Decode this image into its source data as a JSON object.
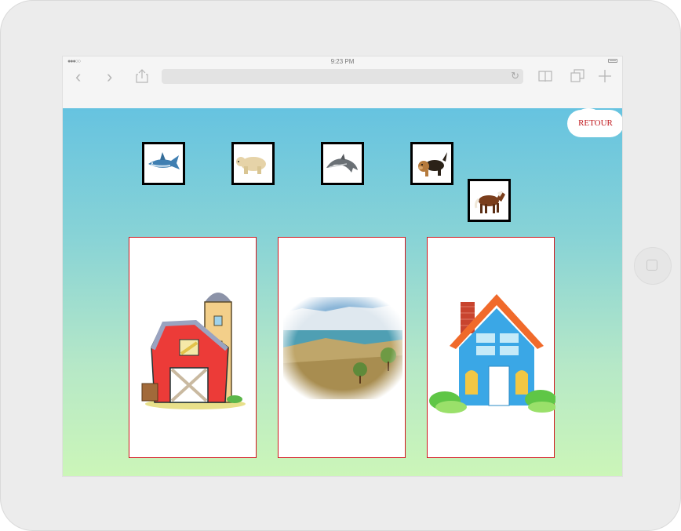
{
  "browser": {
    "status_time": "9:23 PM",
    "signal": "●●●○○"
  },
  "game": {
    "retour_label": "RETOUR",
    "animals": [
      {
        "icon": "shark-icon"
      },
      {
        "icon": "polar-bear-icon"
      },
      {
        "icon": "dolphin-icon"
      },
      {
        "icon": "dog-icon"
      },
      {
        "icon": "horse-icon"
      }
    ],
    "habitats": [
      {
        "icon": "farm-barn-icon"
      },
      {
        "icon": "wild-landscape-icon"
      },
      {
        "icon": "house-icon"
      }
    ]
  },
  "colors": {
    "retour_text": "#c0181d",
    "habitat_border": "#d0141c",
    "gradient_top": "#66c3e0",
    "gradient_bottom": "#ccf6b8"
  }
}
